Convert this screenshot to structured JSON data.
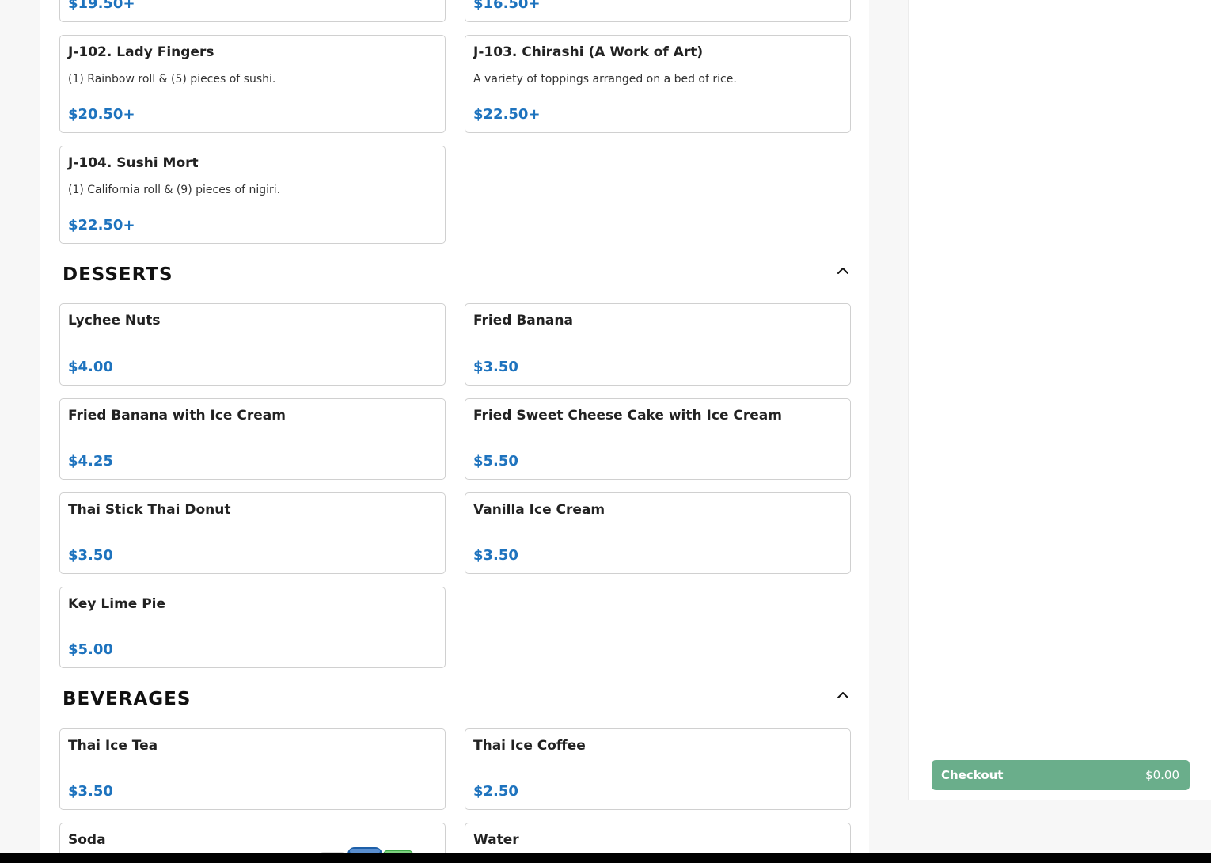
{
  "sushi": {
    "items": [
      {
        "name": "",
        "desc": "",
        "price": "$19.50+"
      },
      {
        "name": "",
        "desc": "",
        "price": "$16.50+"
      },
      {
        "name": "J-102. Lady Fingers",
        "desc": "(1) Rainbow roll & (5) pieces of sushi.",
        "price": "$20.50+"
      },
      {
        "name": "J-103. Chirashi (A Work of Art)",
        "desc": "A variety of toppings arranged on a bed of rice.",
        "price": "$22.50+"
      },
      {
        "name": "J-104. Sushi Mort",
        "desc": "(1) California roll & (9) pieces of nigiri.",
        "price": "$22.50+"
      }
    ]
  },
  "desserts": {
    "title": "DESSERTS",
    "collapse_icon": "chevron-up-icon",
    "items": [
      {
        "name": "Lychee Nuts",
        "price": "$4.00"
      },
      {
        "name": "Fried Banana",
        "price": "$3.50"
      },
      {
        "name": "Fried Banana with Ice Cream",
        "price": "$4.25"
      },
      {
        "name": "Fried Sweet Cheese Cake with Ice Cream",
        "price": "$5.50"
      },
      {
        "name": "Thai Stick Thai Donut",
        "price": "$3.50"
      },
      {
        "name": "Vanilla Ice Cream",
        "price": "$3.50"
      },
      {
        "name": "Key Lime Pie",
        "price": "$5.00"
      }
    ]
  },
  "beverages": {
    "title": "BEVERAGES",
    "collapse_icon": "chevron-up-icon",
    "items": [
      {
        "name": "Thai Ice Tea",
        "price": "$3.50"
      },
      {
        "name": "Thai Ice Coffee",
        "price": "$2.50"
      },
      {
        "name": "Soda",
        "price": "",
        "image": "soda-cans-image"
      },
      {
        "name": "Water",
        "price": ""
      }
    ]
  },
  "cart": {
    "checkout_label": "Checkout",
    "total": "$0.00"
  },
  "colors": {
    "price": "#1e73be",
    "checkout_bg": "#6aae8b",
    "page_bg": "#f7f7f7"
  }
}
